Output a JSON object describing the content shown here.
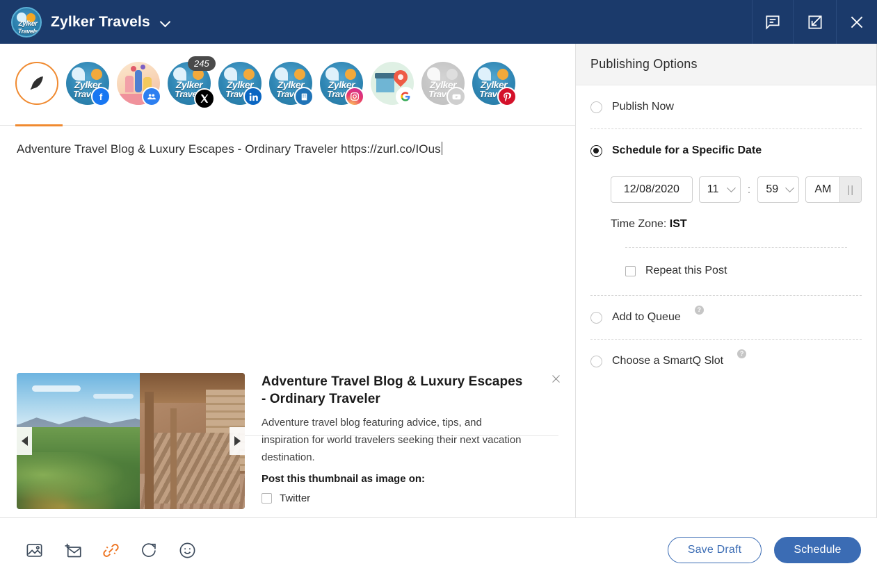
{
  "header": {
    "brand_title": "Zylker Travels",
    "brand_logo_line1": "Zylker",
    "brand_logo_line2": "Travels",
    "dropdown_icon": "chevron-down-icon",
    "actions": [
      {
        "name": "comments-icon",
        "label": "Comments"
      },
      {
        "name": "collapse-icon",
        "label": "Collapse"
      },
      {
        "name": "close-icon",
        "label": "Close"
      }
    ]
  },
  "channels": {
    "active_index": 0,
    "character_count_badge": "245",
    "items": [
      {
        "name": "compose-tab",
        "type": "compose",
        "network": "quill",
        "label": "Compose",
        "active": true
      },
      {
        "name": "channel-facebook",
        "type": "zylker",
        "network": "fb",
        "label": "Facebook",
        "line1": "Zylker",
        "line2": "Travels"
      },
      {
        "name": "channel-facebook-group",
        "type": "illustration",
        "network": "grp",
        "label": "Facebook Group"
      },
      {
        "name": "channel-twitter",
        "type": "zylker",
        "network": "x",
        "label": "X",
        "line1": "Zylker",
        "line2": "Travels",
        "badge": "245"
      },
      {
        "name": "channel-linkedin",
        "type": "zylker",
        "network": "li",
        "label": "LinkedIn",
        "line1": "Zylker",
        "line2": "Travels"
      },
      {
        "name": "channel-linkedin-page",
        "type": "zylker",
        "network": "pg",
        "label": "LinkedIn Page",
        "line1": "Zylker",
        "line2": "Travels"
      },
      {
        "name": "channel-instagram",
        "type": "zylker",
        "network": "ig",
        "label": "Instagram",
        "line1": "Zylker",
        "line2": "Travels"
      },
      {
        "name": "channel-google-business",
        "type": "gbiz",
        "network": "gmb",
        "label": "Google Business Profile"
      },
      {
        "name": "channel-youtube",
        "type": "zylker",
        "network": "yt",
        "label": "YouTube",
        "line1": "Zylker",
        "line2": "Travels",
        "disabled": true
      },
      {
        "name": "channel-pinterest",
        "type": "zylker",
        "network": "pin",
        "label": "Pinterest",
        "line1": "Zylker",
        "line2": "Travels"
      }
    ]
  },
  "editor": {
    "post_text": "Adventure Travel Blog & Luxury Escapes - Ordinary Traveler https://zurl.co/IOus"
  },
  "link_preview": {
    "title": "Adventure Travel Blog & Luxury Escapes - Ordinary Traveler",
    "description": "Adventure travel blog featuring advice, tips, and inspiration for world travelers seeking their next vacation destination.",
    "thumbnail_prompt": "Post this thumbnail as image on:",
    "thumbnail_networks": [
      {
        "label": "Twitter",
        "checked": false
      }
    ],
    "prev_arrow": "prev-image-arrow",
    "next_arrow": "next-image-arrow",
    "close_icon": "close-icon"
  },
  "toolbar": {
    "tools": [
      {
        "name": "add-image-icon",
        "label": "Add Image",
        "active": false
      },
      {
        "name": "add-template-icon",
        "label": "Add Template",
        "active": false
      },
      {
        "name": "shorten-link-icon",
        "label": "Shorten Link",
        "active": true
      },
      {
        "name": "repost-icon",
        "label": "Repost",
        "active": false
      },
      {
        "name": "emoji-icon",
        "label": "Emoji",
        "active": false
      }
    ],
    "save_draft_label": "Save Draft",
    "schedule_label": "Schedule"
  },
  "publishing": {
    "panel_title": "Publishing Options",
    "options": [
      {
        "name": "publish-now",
        "label": "Publish Now",
        "selected": false,
        "help": false
      },
      {
        "name": "schedule-specific-date",
        "label": "Schedule for a Specific Date",
        "selected": true,
        "help": false
      },
      {
        "name": "add-to-queue",
        "label": "Add to Queue",
        "selected": false,
        "help": true
      },
      {
        "name": "choose-smartq-slot",
        "label": "Choose a SmartQ Slot",
        "selected": false,
        "help": true
      }
    ],
    "help_glyph": "?",
    "schedule": {
      "date_value": "12/08/2020",
      "hour_value": "11",
      "minute_value": "59",
      "separator": ":",
      "meridiem_value": "AM",
      "meridiem_toggle_glyph": "||",
      "timezone_label": "Time Zone:",
      "timezone_value": "IST",
      "repeat_label": "Repeat this Post",
      "repeat_checked": false
    }
  },
  "colors": {
    "header_navy": "#1b3a6b",
    "accent_orange": "#f08a30",
    "primary_blue": "#3b6cb4",
    "panel_grey": "#f4f4f4"
  }
}
